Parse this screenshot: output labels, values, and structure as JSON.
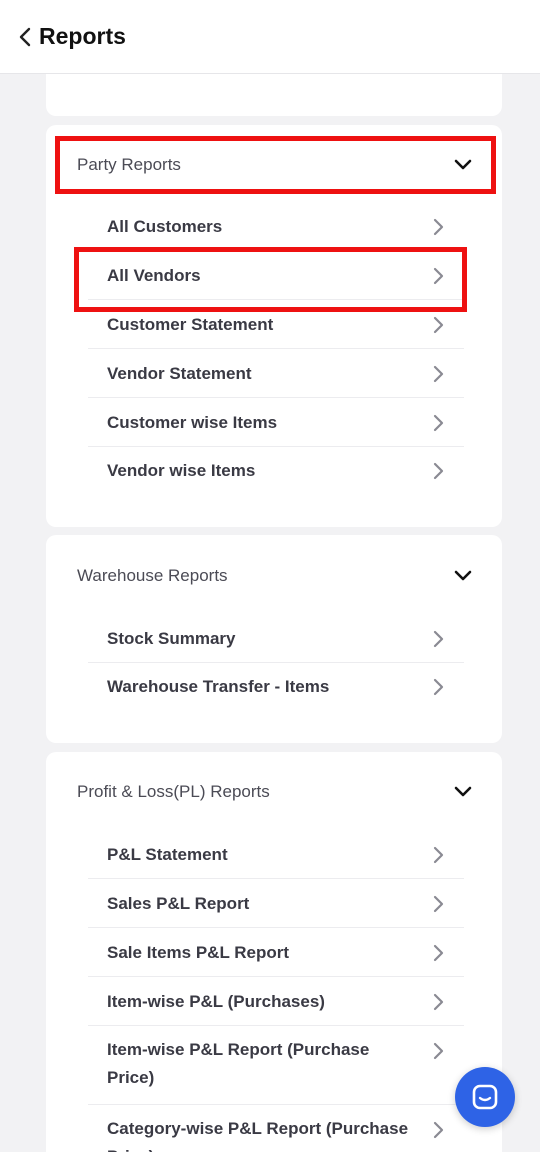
{
  "header": {
    "title": "Reports"
  },
  "sections": {
    "party": {
      "title": "Party Reports",
      "items": [
        "All Customers",
        "All Vendors",
        "Customer Statement",
        "Vendor Statement",
        "Customer wise Items",
        "Vendor wise Items"
      ]
    },
    "warehouse": {
      "title": "Warehouse Reports",
      "items": [
        "Stock Summary",
        "Warehouse Transfer - Items"
      ]
    },
    "pl": {
      "title": "Profit & Loss(PL) Reports",
      "items": [
        "P&L Statement",
        "Sales P&L Report",
        "Sale Items P&L Report",
        "Item-wise P&L (Purchases)",
        "Item-wise P&L Report (Purchase Price)",
        "Category-wise P&L Report (Purchase Price)"
      ]
    }
  },
  "colors": {
    "highlight": "#ee1111",
    "chat_button": "#2e63e6"
  },
  "icons": {
    "back": "chevron-left-icon",
    "expand": "chevron-down-icon",
    "row": "chevron-right-icon",
    "chat": "chat-icon"
  }
}
